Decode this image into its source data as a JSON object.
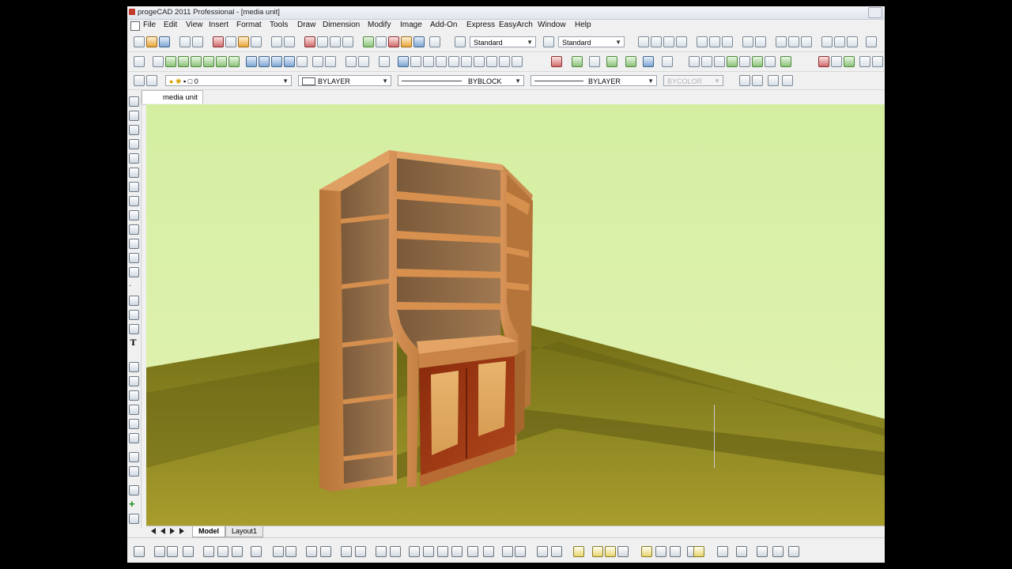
{
  "window": {
    "title": "progeCAD 2011 Professional - [media unit]"
  },
  "menu": [
    {
      "label": "File"
    },
    {
      "label": "Edit"
    },
    {
      "label": "View"
    },
    {
      "label": "Insert"
    },
    {
      "label": "Format"
    },
    {
      "label": "Tools"
    },
    {
      "label": "Draw"
    },
    {
      "label": "Dimension"
    },
    {
      "label": "Modify"
    },
    {
      "label": "Image"
    },
    {
      "label": "Add-On"
    },
    {
      "label": "Express"
    },
    {
      "label": "EasyArch"
    },
    {
      "label": "Window"
    },
    {
      "label": "Help"
    }
  ],
  "toolbar": {
    "text_style": "Standard",
    "dim_style": "Standard"
  },
  "properties": {
    "layer": "0",
    "color": "BYLAYER",
    "linetype": "BYBLOCK",
    "lineweight": "BYLAYER",
    "plotstyle": "BYCOLOR"
  },
  "document": {
    "tab_name": "media unit"
  },
  "layout_tabs": [
    {
      "label": "Model"
    },
    {
      "label": "Layout1"
    }
  ],
  "colors": {
    "sky": "#d9f0a6",
    "ground": "#8a8420",
    "wood_light": "#c98a4e",
    "wood_dark": "#9a3b12"
  }
}
